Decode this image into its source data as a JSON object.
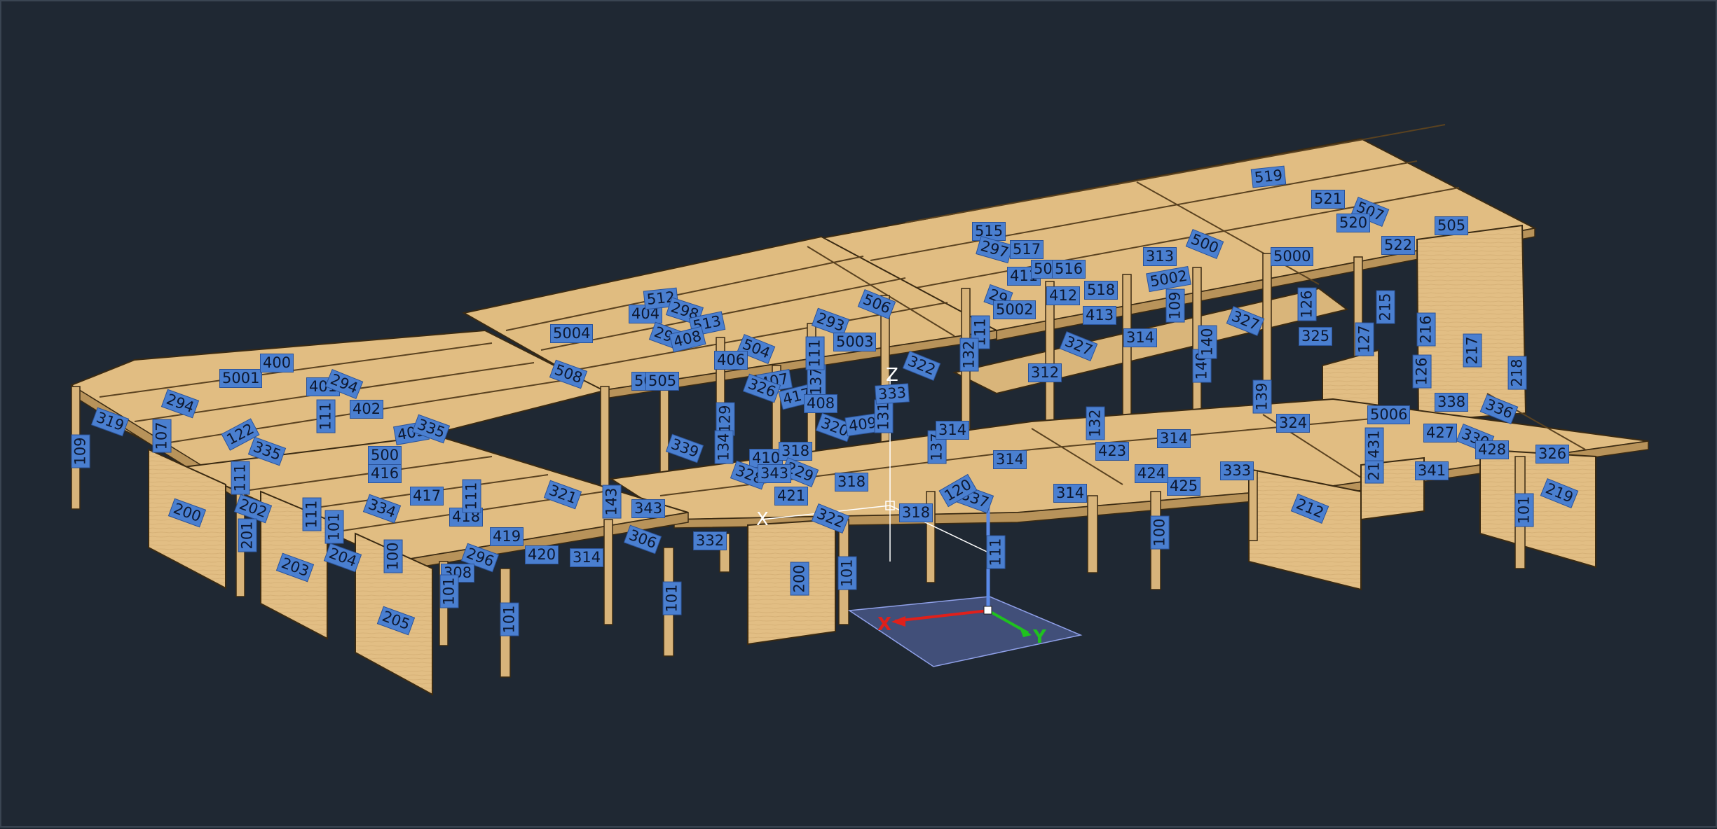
{
  "viewport": {
    "background": "#1f2833",
    "model_colors": {
      "slab": "#e0bc80",
      "slab_edge": "#2a1f10",
      "wall": "#e3bf86",
      "column": "#d8b47a"
    },
    "tag_color": "#4a7fd0",
    "ucs": {
      "x_label": "X",
      "y_label": "Y",
      "x_color": "#e0201b",
      "y_color": "#1fc21f",
      "z_color": "#5a8ae8"
    },
    "crosshair": {
      "x_label": "X",
      "y_label": "Y",
      "z_label": "Z"
    },
    "labels": {
      "t1": "519",
      "t2": "521",
      "t3": "507",
      "t4": "520",
      "t5": "505",
      "t6": "522",
      "t7": "5000",
      "t8": "500",
      "t9": "313",
      "t10": "5002",
      "t11": "515",
      "t12": "297",
      "t13": "517",
      "t14": "411",
      "t15": "508",
      "t16": "516",
      "t17": "412",
      "t18": "518",
      "t19": "29",
      "t20": "5002",
      "t21": "413",
      "t22": "109",
      "t23": "314",
      "t24": "327",
      "t25": "126",
      "t26": "215",
      "t27": "216",
      "t28": "325",
      "t29": "127",
      "t30": "217",
      "t31": "126",
      "t32": "218",
      "t33": "506",
      "t34": "293",
      "t35": "5003",
      "t36": "322",
      "t37": "111",
      "t38": "132",
      "t39": "327",
      "t40": "139",
      "t41": "140",
      "t42": "338",
      "t43": "336",
      "t44": "5006",
      "t45": "324",
      "t46": "427",
      "t47": "330",
      "t48": "428",
      "t49": "326",
      "t50": "219",
      "t51": "341",
      "t52": "213",
      "t53": "431",
      "t54": "212",
      "t55": "101",
      "t56": "333",
      "t57": "314",
      "t58": "425",
      "t59": "424",
      "t60": "423",
      "t61": "314",
      "t62": "100",
      "t63": "132",
      "t64": "137",
      "t65": "314",
      "t66": "314",
      "t67": "337",
      "t68": "120",
      "t69": "318",
      "t70": "318",
      "t71": "101",
      "t72": "200",
      "t73": "332",
      "t74": "306",
      "t75": "343",
      "t76": "322",
      "t77": "421",
      "t78": "410",
      "t79": "318",
      "t80": "229",
      "t81": "328",
      "t82": "343",
      "t83": "5004",
      "t84": "404",
      "t85": "512",
      "t86": "298",
      "t87": "513",
      "t88": "294",
      "t89": "408",
      "t90": "504",
      "t91": "406",
      "t92": "508",
      "t93": "501",
      "t94": "505",
      "t95": "129",
      "t96": "134",
      "t97": "339",
      "t98": "407",
      "t99": "326",
      "t100": "417",
      "t101": "137",
      "t102": "408",
      "t103": "320",
      "t104": "409",
      "t105": "111",
      "t106": "5001",
      "t107": "400",
      "t108": "401",
      "t109": "294",
      "t110": "402",
      "t111": "294",
      "t112": "319",
      "t113": "107",
      "t114": "109",
      "t115": "122",
      "t116": "335",
      "t117": "403",
      "t118": "335",
      "t119": "500",
      "t120": "416",
      "t121": "111",
      "t122": "111",
      "t123": "200",
      "t124": "202",
      "t125": "201",
      "t126": "111",
      "t127": "101",
      "t128": "417",
      "t129": "418",
      "t130": "334",
      "t131": "321",
      "t132": "111",
      "t133": "143",
      "t134": "419",
      "t135": "203",
      "t136": "204",
      "t137": "100",
      "t138": "420",
      "t139": "314",
      "t140": "296",
      "t141": "308",
      "t142": "101",
      "t143": "205",
      "t144": "101",
      "t145": "101",
      "t146": "111",
      "t147": "131",
      "t148": "140",
      "t149": "333",
      "t150": "312"
    }
  }
}
